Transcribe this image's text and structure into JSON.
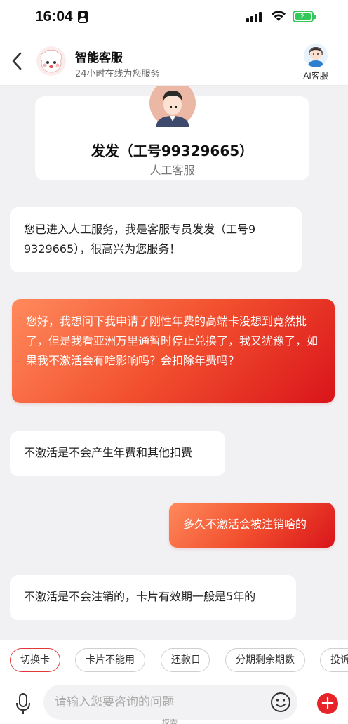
{
  "status_bar": {
    "time": "16:04"
  },
  "header": {
    "back_icon": "chevron-left-icon",
    "title": "智能客服",
    "subtitle": "24小时在线为您服务",
    "ai_service_label": "AI客服"
  },
  "agent_card": {
    "name": "发发（工号99329665）",
    "role": "人工客服"
  },
  "messages": [
    {
      "side": "left",
      "text": "您已进入人工服务，我是客服专员发发（工号9\n9329665），很高兴为您服务！"
    },
    {
      "side": "right",
      "text": "您好，我想问下我申请了刚性年费的高端卡没想到竟然批了，但是我看亚洲万里通暂时停止兑换了，我又犹豫了，如果我不激活会有啥影响吗？会扣除年费吗？"
    },
    {
      "side": "left",
      "text": "不激活是不会产生年费和其他扣费"
    },
    {
      "side": "right",
      "text": "多久不激活会被注销啥的"
    },
    {
      "side": "left",
      "text": "不激活是不会注销的，卡片有效期一般是5年的"
    }
  ],
  "quick_chips": [
    "切换卡",
    "卡片不能用",
    "还款日",
    "分期剩余期数",
    "投诉"
  ],
  "input": {
    "placeholder": "请输入您要咨询的问题",
    "below_label": "探索"
  },
  "colors": {
    "accent": "#e7232a",
    "bubble_gradient_start": "#ff8a5c",
    "bubble_gradient_end": "#d9141a",
    "background": "#f1f1f3"
  }
}
